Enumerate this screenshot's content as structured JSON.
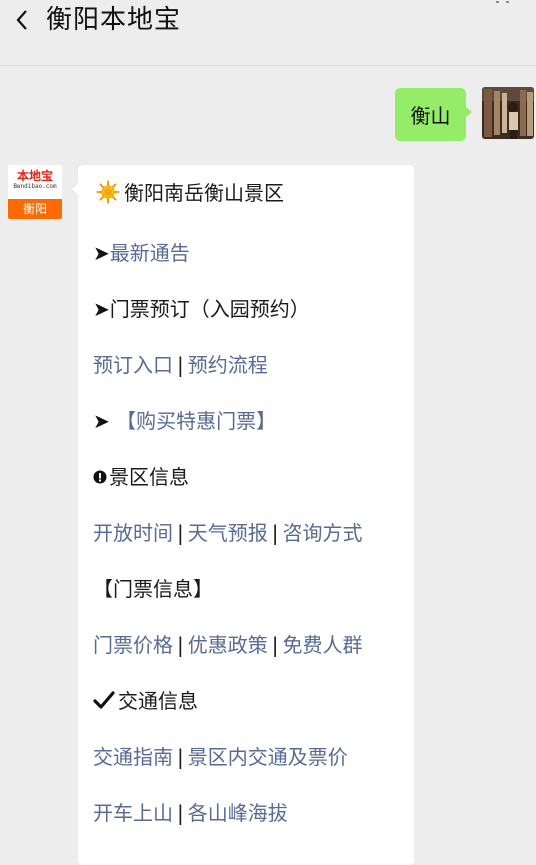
{
  "header": {
    "title": "衡阳本地宝",
    "back_icon": "chevron-left-icon"
  },
  "user_message": {
    "text": "衡山",
    "bubble_color": "#95ec69"
  },
  "bot": {
    "avatar": {
      "logo_text": "本地宝",
      "logo_sub": "Bendibao.com",
      "city": "衡阳",
      "accent": "#ff6a00"
    },
    "lines": {
      "title": "衡阳南岳衡山景区",
      "notice_arrow": "➤",
      "notice": "最新通告",
      "ticket_arrow": "➤",
      "ticket": "门票预订（入园预约）",
      "booking_entry": "预订入口",
      "booking_flow": "预约流程",
      "special_arrow": "➤",
      "special": "【购买特惠门票】",
      "scenic_info": "景区信息",
      "open_time": "开放时间",
      "weather": "天气预报",
      "contact": "咨询方式",
      "ticket_info": "【门票信息】",
      "price": "门票价格",
      "discount": "优惠政策",
      "free": "免费人群",
      "traffic": "交通信息",
      "traffic_guide": "交通指南",
      "inner_traffic": "景区内交通及票价",
      "drive": "开车上山",
      "altitude": "各山峰海拔",
      "separator": "|"
    },
    "link_color": "#576b95"
  }
}
